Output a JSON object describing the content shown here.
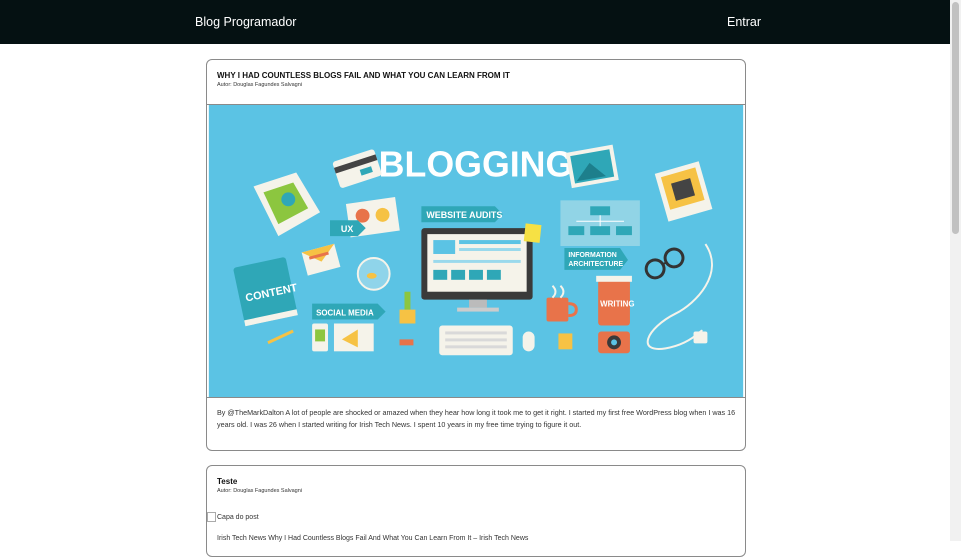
{
  "navbar": {
    "brand": "Blog Programador",
    "login": "Entrar"
  },
  "posts": [
    {
      "title": "WHY I HAD COUNTLESS BLOGS FAIL AND WHAT YOU CAN LEARN FROM IT",
      "author": "Autor: Douglas Fagundes Salvagni",
      "image": {
        "headline": "BLOGGING",
        "tags": [
          "UX",
          "WEBSITE AUDITS",
          "INFORMATION",
          "ARCHITECTURE",
          "CONTENT",
          "SOCIAL MEDIA",
          "WRITING"
        ]
      },
      "excerpt": "By @TheMarkDalton A lot of people are shocked or amazed when they hear how long it took me to get it right. I started my first free WordPress blog when I was 16 years old. I was 26 when I started writing for Irish Tech News. I spent 10 years in my free time trying to figure it out."
    },
    {
      "title": "Teste",
      "author": "Autor: Douglas Fagundes Salvagni",
      "image_alt": "Capa do post",
      "excerpt": "Irish Tech News Why I Had Countless Blogs Fail And What You Can Learn From It – Irish Tech News"
    }
  ],
  "colors": {
    "navbar": "#051112",
    "hero_bg": "#5bc3e4",
    "accent_teal": "#2fa7b7"
  }
}
